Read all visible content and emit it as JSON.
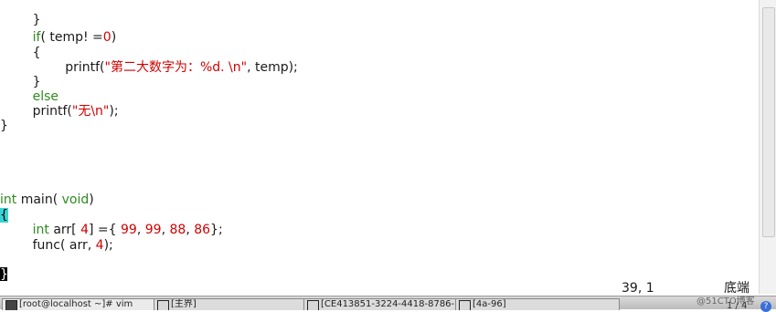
{
  "editor": {
    "lines": [
      {
        "text": "        }"
      },
      {
        "text_kw": "if",
        "text_rest1": "( temp! =",
        "text_num": "0",
        "text_rest2": ")"
      },
      {
        "text": "        {"
      },
      {
        "text_fn": "printf(",
        "text_str": "\"第二大数字为：%d. \\n\"",
        "text_rest": ", temp);"
      },
      {
        "text": "        }"
      },
      {
        "text_kw": "else"
      },
      {
        "text_fn": "printf(",
        "text_str": "\"无\\n\"",
        "text_rest": ");"
      },
      {
        "text": "}"
      },
      {
        "text_type": "int",
        "text_rest": " main( ",
        "text_type2": "void",
        "text_rest2": ")"
      },
      {
        "text": "{"
      },
      {
        "text_type": "int",
        "text_rest": " arr[ ",
        "n1": "4",
        "text_rest2": "] ={ ",
        "n2": "99",
        "c1": ", ",
        "n3": "99",
        "c2": ", ",
        "n4": "88",
        "c3": ", ",
        "n5": "86",
        "text_rest3": "};"
      },
      {
        "text_fn": "func( arr, ",
        "n1": "4",
        "text_rest": ");"
      },
      {
        "text": "}"
      }
    ]
  },
  "status": {
    "position": "39, 1",
    "scroll": "底端"
  },
  "taskbar": {
    "items": [
      {
        "label": "[root@localhost ~]# vim"
      },
      {
        "label": "[主界]"
      },
      {
        "label": "[CE413851-3224-4418-8786-"
      },
      {
        "label": "[4a-96]"
      }
    ]
  },
  "watermark": "@51CTO博客",
  "page_indicator": "1 / 4"
}
